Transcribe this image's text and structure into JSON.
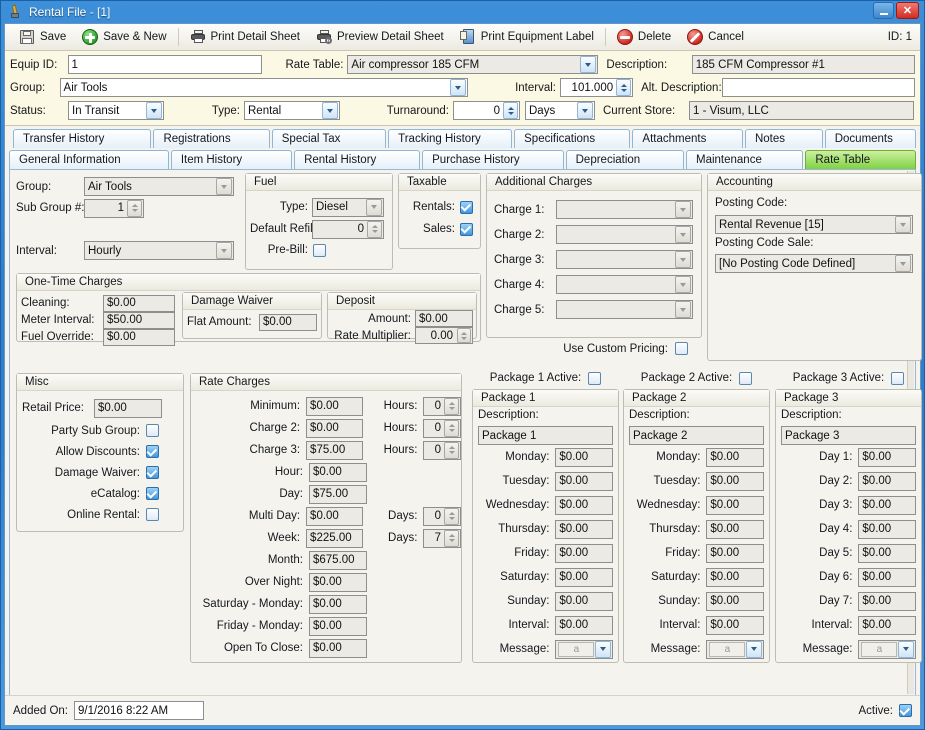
{
  "window": {
    "title": "Rental File - [1]",
    "icon": "key-icon",
    "minimize_label": "Minimize",
    "close_label": "Close"
  },
  "toolbar": {
    "buttons": [
      {
        "label": "Save",
        "icon": "save-icon"
      },
      {
        "label": "Save & New",
        "icon": "add-circle-icon"
      },
      {
        "label": "Print Detail Sheet",
        "icon": "printer-icon"
      },
      {
        "label": "Preview Detail Sheet",
        "icon": "print-preview-icon"
      },
      {
        "label": "Print Equipment Label",
        "icon": "label-printer-icon"
      },
      {
        "label": "Delete",
        "icon": "delete-circle-icon"
      },
      {
        "label": "Cancel",
        "icon": "cancel-circle-icon"
      }
    ],
    "id_text": "ID: 1"
  },
  "header": {
    "equip_id_label": "Equip ID:",
    "equip_id_value": "1",
    "group_label": "Group:",
    "group_value": "Air Tools",
    "status_label": "Status:",
    "status_value": "In Transit",
    "type_label": "Type:",
    "type_value": "Rental",
    "rate_table_label": "Rate Table:",
    "rate_table_value": "Air compressor  185 CFM",
    "interval_label": "Interval:",
    "interval_value": "101.000",
    "turnaround_label": "Turnaround:",
    "turnaround_value": "0",
    "turnaround_unit": "Days",
    "description_label": "Description:",
    "description_value": "185 CFM Compressor #1",
    "alt_description_label": "Alt. Description:",
    "alt_description_value": "",
    "current_store_label": "Current Store:",
    "current_store_value": "1 - Visum, LLC"
  },
  "tabs": {
    "row1": [
      "Transfer History",
      "Registrations",
      "Special Tax",
      "Tracking History",
      "Specifications",
      "Attachments",
      "Notes",
      "Documents"
    ],
    "row2": [
      "General Information",
      "Item History",
      "Rental History",
      "Purchase History",
      "Depreciation",
      "Maintenance",
      "Rate Table"
    ],
    "active": "Rate Table",
    "active_color": "#7fd144"
  },
  "group_panel": {
    "group_label": "Group:",
    "group_value": "Air Tools",
    "sub_group_label": "Sub Group #:",
    "sub_group_value": "1",
    "interval_label": "Interval:",
    "interval_value": "Hourly"
  },
  "fuel": {
    "caption": "Fuel",
    "type_label": "Type:",
    "type_value": "Diesel",
    "default_refill_label": "Default Refill:",
    "default_refill_value": "0",
    "prebill_label": "Pre-Bill:",
    "prebill_checked": false
  },
  "taxable": {
    "caption": "Taxable",
    "rentals_label": "Rentals:",
    "rentals_checked": true,
    "sales_label": "Sales:",
    "sales_checked": true
  },
  "additional_charges": {
    "caption": "Additional Charges",
    "rows": [
      {
        "label": "Charge 1:",
        "value": ""
      },
      {
        "label": "Charge 2:",
        "value": ""
      },
      {
        "label": "Charge 3:",
        "value": ""
      },
      {
        "label": "Charge 4:",
        "value": ""
      },
      {
        "label": "Charge 5:",
        "value": ""
      }
    ],
    "use_custom_pricing_label": "Use Custom Pricing:",
    "use_custom_pricing_checked": false
  },
  "accounting": {
    "caption": "Accounting",
    "posting_code_label": "Posting Code:",
    "posting_code_value": "Rental Revenue [15]",
    "posting_code_sale_label": "Posting Code Sale:",
    "posting_code_sale_value": "[No Posting Code Defined]"
  },
  "one_time_charges": {
    "caption": "One-Time Charges",
    "cleaning_label": "Cleaning:",
    "cleaning_value": "$0.00",
    "meter_interval_label": "Meter Interval:",
    "meter_interval_value": "$50.00",
    "fuel_override_label": "Fuel Override:",
    "fuel_override_value": "$0.00",
    "damage_waiver_caption": "Damage Waiver",
    "flat_amount_label": "Flat Amount:",
    "flat_amount_value": "$0.00",
    "deposit_caption": "Deposit",
    "deposit_amount_label": "Amount:",
    "deposit_amount_value": "$0.00",
    "rate_multiplier_label": "Rate Multiplier:",
    "rate_multiplier_value": "0.00"
  },
  "misc": {
    "caption": "Misc",
    "retail_price_label": "Retail Price:",
    "retail_price_value": "$0.00",
    "checks": [
      {
        "label": "Party Sub Group:",
        "checked": false
      },
      {
        "label": "Allow Discounts:",
        "checked": true
      },
      {
        "label": "Damage Waiver:",
        "checked": true
      },
      {
        "label": "eCatalog:",
        "checked": true
      },
      {
        "label": "Online Rental:",
        "checked": false
      }
    ]
  },
  "rate_charges": {
    "caption": "Rate Charges",
    "rows": [
      {
        "label": "Minimum:",
        "value": "$0.00",
        "unit_label": "Hours:",
        "unit_value": "0"
      },
      {
        "label": "Charge 2:",
        "value": "$0.00",
        "unit_label": "Hours:",
        "unit_value": "0"
      },
      {
        "label": "Charge 3:",
        "value": "$75.00",
        "unit_label": "Hours:",
        "unit_value": "0"
      },
      {
        "label": "Hour:",
        "value": "$0.00",
        "unit_label": "",
        "unit_value": ""
      },
      {
        "label": "Day:",
        "value": "$75.00",
        "unit_label": "",
        "unit_value": ""
      },
      {
        "label": "Multi Day:",
        "value": "$0.00",
        "unit_label": "Days:",
        "unit_value": "0"
      },
      {
        "label": "Week:",
        "value": "$225.00",
        "unit_label": "Days:",
        "unit_value": "7"
      },
      {
        "label": "Month:",
        "value": "$675.00",
        "unit_label": "",
        "unit_value": ""
      },
      {
        "label": "Over Night:",
        "value": "$0.00",
        "unit_label": "",
        "unit_value": ""
      },
      {
        "label": "Saturday - Monday:",
        "value": "$0.00",
        "unit_label": "",
        "unit_value": ""
      },
      {
        "label": "Friday - Monday:",
        "value": "$0.00",
        "unit_label": "",
        "unit_value": ""
      },
      {
        "label": "Open To Close:",
        "value": "$0.00",
        "unit_label": "",
        "unit_value": ""
      }
    ]
  },
  "packages": [
    {
      "active_label": "Package 1 Active:",
      "active_checked": false,
      "caption": "Package 1",
      "description_label": "Description:",
      "description_value": "Package 1",
      "rows": [
        {
          "label": "Monday:",
          "value": "$0.00"
        },
        {
          "label": "Tuesday:",
          "value": "$0.00"
        },
        {
          "label": "Wednesday:",
          "value": "$0.00"
        },
        {
          "label": "Thursday:",
          "value": "$0.00"
        },
        {
          "label": "Friday:",
          "value": "$0.00"
        },
        {
          "label": "Saturday:",
          "value": "$0.00"
        },
        {
          "label": "Sunday:",
          "value": "$0.00"
        },
        {
          "label": "Interval:",
          "value": "$0.00"
        }
      ],
      "message_label": "Message:",
      "message_value": "a"
    },
    {
      "active_label": "Package 2 Active:",
      "active_checked": false,
      "caption": "Package 2",
      "description_label": "Description:",
      "description_value": "Package 2",
      "rows": [
        {
          "label": "Monday:",
          "value": "$0.00"
        },
        {
          "label": "Tuesday:",
          "value": "$0.00"
        },
        {
          "label": "Wednesday:",
          "value": "$0.00"
        },
        {
          "label": "Thursday:",
          "value": "$0.00"
        },
        {
          "label": "Friday:",
          "value": "$0.00"
        },
        {
          "label": "Saturday:",
          "value": "$0.00"
        },
        {
          "label": "Sunday:",
          "value": "$0.00"
        },
        {
          "label": "Interval:",
          "value": "$0.00"
        }
      ],
      "message_label": "Message:",
      "message_value": "a"
    },
    {
      "active_label": "Package 3 Active:",
      "active_checked": false,
      "caption": "Package 3",
      "description_label": "Description:",
      "description_value": "Package 3",
      "rows": [
        {
          "label": "Day 1:",
          "value": "$0.00"
        },
        {
          "label": "Day 2:",
          "value": "$0.00"
        },
        {
          "label": "Day 3:",
          "value": "$0.00"
        },
        {
          "label": "Day 4:",
          "value": "$0.00"
        },
        {
          "label": "Day 5:",
          "value": "$0.00"
        },
        {
          "label": "Day 6:",
          "value": "$0.00"
        },
        {
          "label": "Day 7:",
          "value": "$0.00"
        },
        {
          "label": "Interval:",
          "value": "$0.00"
        }
      ],
      "message_label": "Message:",
      "message_value": "a"
    }
  ],
  "footer": {
    "added_on_label": "Added On:",
    "added_on_value": "9/1/2016 8:22 AM",
    "active_label": "Active:",
    "active_checked": true
  }
}
